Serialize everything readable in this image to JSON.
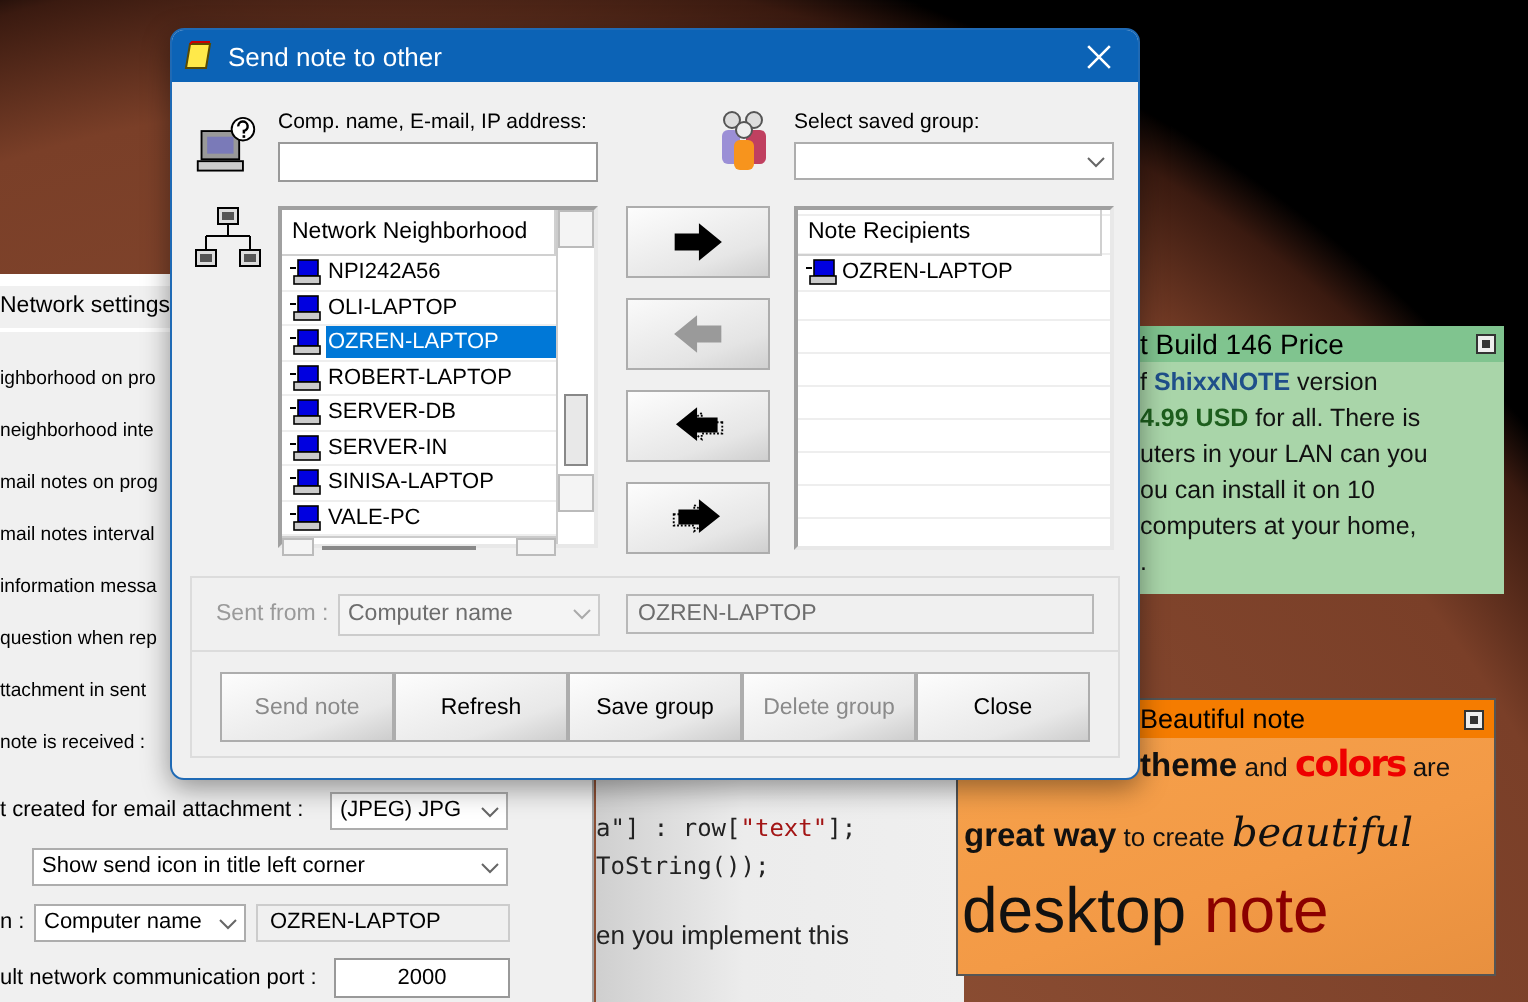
{
  "settings_window": {
    "tab": "Network settings",
    "labels": [
      "ighborhood on pro",
      "neighborhood inte",
      "mail notes on prog",
      "mail notes interval",
      "information messa",
      "question when rep",
      "ttachment in sent",
      "note is received :"
    ],
    "attachment": {
      "label": "t created for email attachment :",
      "value": "(JPEG) JPG"
    },
    "send_icon": {
      "value": "Show send icon in title left corner"
    },
    "sent_from": {
      "label": "n :",
      "value": "Computer name",
      "field": "OZREN-LAPTOP"
    },
    "port": {
      "label": "ult network communication port :",
      "value": "2000"
    }
  },
  "code_window": {
    "lines": [
      [
        {
          "text": "a\"] : row[",
          "kind": "plain"
        },
        {
          "text": "\"text\"",
          "kind": "string"
        },
        {
          "text": "];",
          "kind": "plain"
        }
      ],
      [
        {
          "text": "ToString());",
          "kind": "plain"
        }
      ]
    ],
    "prose": "en you implement this"
  },
  "green_note": {
    "title": "t Build 146 Price",
    "lines": [
      [
        {
          "text": "f ",
          "kind": "plain"
        },
        {
          "text": "ShixxNOTE",
          "kind": "brand"
        },
        {
          "text": " version",
          "kind": "plain"
        }
      ],
      [
        {
          "text": "4.99 USD",
          "kind": "price"
        },
        {
          "text": " for all. There is",
          "kind": "plain"
        }
      ],
      [
        {
          "text": "uters in your LAN can you",
          "kind": "plain"
        }
      ],
      [
        {
          "text": "ou can install it on 10",
          "kind": "plain"
        }
      ],
      [
        {
          "text": "computers at your home,",
          "kind": "plain"
        }
      ],
      [
        {
          "text": ".",
          "kind": "plain"
        }
      ]
    ]
  },
  "orange_note": {
    "title": "Beautiful note",
    "lines": [
      [
        {
          "text": "theme",
          "kind": "bold"
        },
        {
          "text": " and ",
          "kind": "small"
        },
        {
          "text": "colors",
          "kind": "red"
        },
        {
          "text": " are",
          "kind": "small"
        }
      ],
      [
        {
          "text": "great way",
          "kind": "bold"
        },
        {
          "text": " to create ",
          "kind": "small"
        },
        {
          "text": "beautiful",
          "kind": "script"
        }
      ],
      [
        {
          "text": "desktop ",
          "kind": "big"
        },
        {
          "text": "note",
          "kind": "bigred"
        }
      ]
    ]
  },
  "dialog": {
    "title": "Send note to other",
    "address": {
      "label": "Comp. name, E-mail, IP address:"
    },
    "group": {
      "label": "Select saved group:"
    },
    "network": {
      "header": "Network Neighborhood",
      "items": [
        {
          "name": "NPI242A56",
          "selected": false
        },
        {
          "name": "OLI-LAPTOP",
          "selected": false
        },
        {
          "name": "OZREN-LAPTOP",
          "selected": true
        },
        {
          "name": "ROBERT-LAPTOP",
          "selected": false
        },
        {
          "name": "SERVER-DB",
          "selected": false
        },
        {
          "name": "SERVER-IN",
          "selected": false
        },
        {
          "name": "SINISA-LAPTOP",
          "selected": false
        },
        {
          "name": "VALE-PC",
          "selected": false
        }
      ]
    },
    "arrow_buttons": [
      {
        "kind": "add",
        "disabled": false
      },
      {
        "kind": "remove",
        "disabled": true
      },
      {
        "kind": "remove_all",
        "disabled": false
      },
      {
        "kind": "add_all",
        "disabled": false
      }
    ],
    "recipients": {
      "header": "Note Recipients",
      "items": [
        {
          "name": "OZREN-LAPTOP"
        }
      ]
    },
    "sent_from": {
      "label": "Sent from :",
      "value": "Computer name",
      "field": "OZREN-LAPTOP",
      "disabled": true
    },
    "buttons": [
      {
        "label": "Send note",
        "disabled": true
      },
      {
        "label": "Refresh",
        "disabled": false
      },
      {
        "label": "Save group",
        "disabled": false
      },
      {
        "label": "Delete group",
        "disabled": true
      },
      {
        "label": "Close",
        "disabled": false
      }
    ]
  }
}
